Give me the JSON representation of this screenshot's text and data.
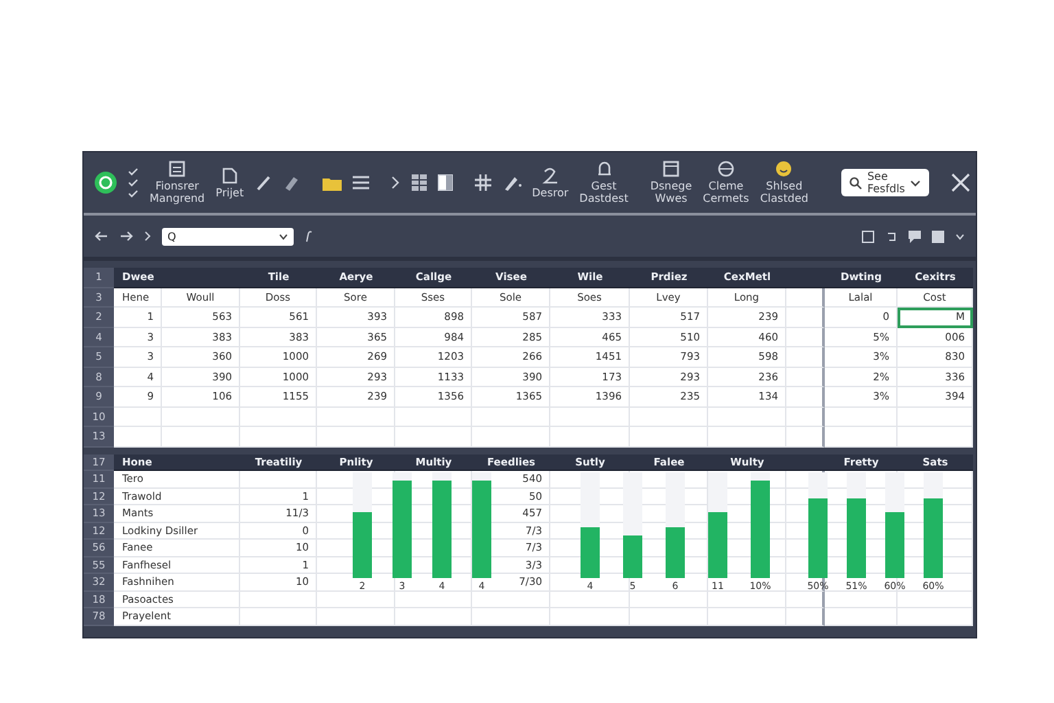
{
  "toolbar": {
    "labels": [
      "Fionsrer Mangrend",
      "Prijet",
      "Desror",
      "Gest Dastdest",
      "Dsnege Wwes",
      "Cleme Cermets",
      "Shlsed Clastded"
    ],
    "search": {
      "placeholder": "See Fesfdls"
    }
  },
  "formula_bar": {
    "name_box": "Q"
  },
  "top_table": {
    "row_number": "1",
    "header": [
      "Dwee",
      "Tile",
      "Aerye",
      "Callge",
      "Visee",
      "Wile",
      "Prdiez",
      "CexMetl",
      "Dwting",
      "Cexitrs"
    ],
    "rows": [
      {
        "row_number": "3",
        "cells": [
          "Hene",
          "Woull",
          "Doss",
          "Sore",
          "Sses",
          "Sole",
          "Soes",
          "Lvey",
          "Long",
          "Lalal",
          "Cost"
        ]
      },
      {
        "row_number": "2",
        "cells": [
          "1",
          "563",
          "561",
          "393",
          "898",
          "587",
          "333",
          "517",
          "239",
          "0",
          {
            "text": "M",
            "selected": true
          }
        ]
      },
      {
        "row_number": "4",
        "cells": [
          "3",
          "383",
          "383",
          "365",
          "984",
          "285",
          "465",
          "510",
          "460",
          "5%",
          "006"
        ]
      },
      {
        "row_number": "5",
        "cells": [
          "3",
          "360",
          "1000",
          "269",
          "1203",
          "266",
          "1451",
          "793",
          "598",
          "3%",
          "830"
        ]
      },
      {
        "row_number": "8",
        "cells": [
          "4",
          "390",
          "1000",
          "293",
          "1133",
          "390",
          "173",
          "293",
          "236",
          "2%",
          "336"
        ]
      },
      {
        "row_number": "9",
        "cells": [
          "9",
          "106",
          "1155",
          "239",
          "1356",
          "1365",
          "1396",
          "235",
          "134",
          "3%",
          "394"
        ]
      },
      {
        "row_number": "10",
        "cells": []
      },
      {
        "row_number": "13",
        "cells": []
      }
    ]
  },
  "bottom_table": {
    "row_number": "17",
    "header": [
      "Hone",
      "Treatiliy",
      "Pnlity",
      "Multiy",
      "Feedlies",
      "Sutly",
      "Falee",
      "Wulty",
      "Fretty",
      "Sats"
    ],
    "rows": [
      {
        "row_number": "11",
        "label": "Tero",
        "column_f": "540"
      },
      {
        "row_number": "12",
        "label": "Trawold",
        "value": "1",
        "column_f": "50"
      },
      {
        "row_number": "13",
        "label": "Mants",
        "value": "11/3",
        "column_f": "457"
      },
      {
        "row_number": "12",
        "label": "Lodkiny Dsiller",
        "value": "0",
        "column_f": "7/3"
      },
      {
        "row_number": "56",
        "label": "Fanee",
        "value": "10",
        "column_f": "7/3"
      },
      {
        "row_number": "55",
        "label": "Fanfhesel",
        "value": "1",
        "column_f": "3/3"
      },
      {
        "row_number": "32",
        "label": "Fashnihen",
        "value": "10",
        "column_f": "7/30"
      },
      {
        "row_number": "18",
        "label": "Pasoactes"
      },
      {
        "row_number": "78",
        "label": "Prayelent"
      }
    ],
    "bar_groups": [
      {
        "bars": [
          {
            "label": "2",
            "level": 0.62
          },
          {
            "label": "3",
            "level": 0.92
          },
          {
            "label": "4",
            "level": 0.92
          },
          {
            "label": "4",
            "level": 0.92
          }
        ]
      },
      {
        "bars": [
          {
            "label": "4",
            "level": 0.47
          },
          {
            "label": "5",
            "level": 0.4
          },
          {
            "label": "6",
            "level": 0.47
          },
          {
            "label": "11",
            "level": 0.62
          },
          {
            "label": "10%",
            "level": 0.92
          }
        ]
      },
      {
        "bars": [
          {
            "label": "50%",
            "level": 0.75
          },
          {
            "label": "51%",
            "level": 0.75
          },
          {
            "label": "60%",
            "level": 0.62
          },
          {
            "label": "60%",
            "level": 0.75
          }
        ]
      }
    ]
  }
}
